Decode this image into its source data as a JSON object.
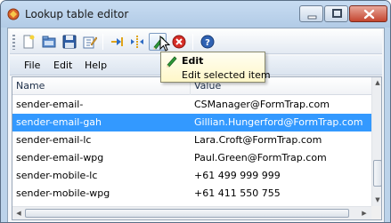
{
  "window": {
    "title": "Lookup table editor"
  },
  "toolbar": {
    "buttons": [
      {
        "name": "new-icon"
      },
      {
        "name": "open-icon"
      },
      {
        "name": "save-icon"
      },
      {
        "name": "properties-icon"
      },
      {
        "name": "insert-row-icon"
      },
      {
        "name": "insert-column-icon"
      },
      {
        "name": "edit-icon"
      },
      {
        "name": "delete-icon"
      },
      {
        "name": "help-icon"
      }
    ]
  },
  "menu": {
    "file": "File",
    "edit": "Edit",
    "help": "Help"
  },
  "tooltip": {
    "title": "Edit",
    "description": "Edit selected item"
  },
  "list": {
    "columns": {
      "name": "Name",
      "value": "Value"
    },
    "rows": [
      {
        "name": "sender-email-",
        "value": "CSManager@FormTrap.com",
        "selected": false
      },
      {
        "name": "sender-email-gah",
        "value": "Gillian.Hungerford@FormTrap.com",
        "selected": true
      },
      {
        "name": "sender-email-lc",
        "value": "Lara.Croft@FormTrap.com",
        "selected": false
      },
      {
        "name": "sender-email-wpg",
        "value": "Paul.Green@FormTrap.com",
        "selected": false
      },
      {
        "name": "sender-mobile-lc",
        "value": "+61 499 999 999",
        "selected": false
      },
      {
        "name": "sender-mobile-wpg",
        "value": "+61 411 550 755",
        "selected": false
      }
    ]
  },
  "colors": {
    "selection": "#3399ff",
    "titlebar": "#bcd3ea"
  }
}
